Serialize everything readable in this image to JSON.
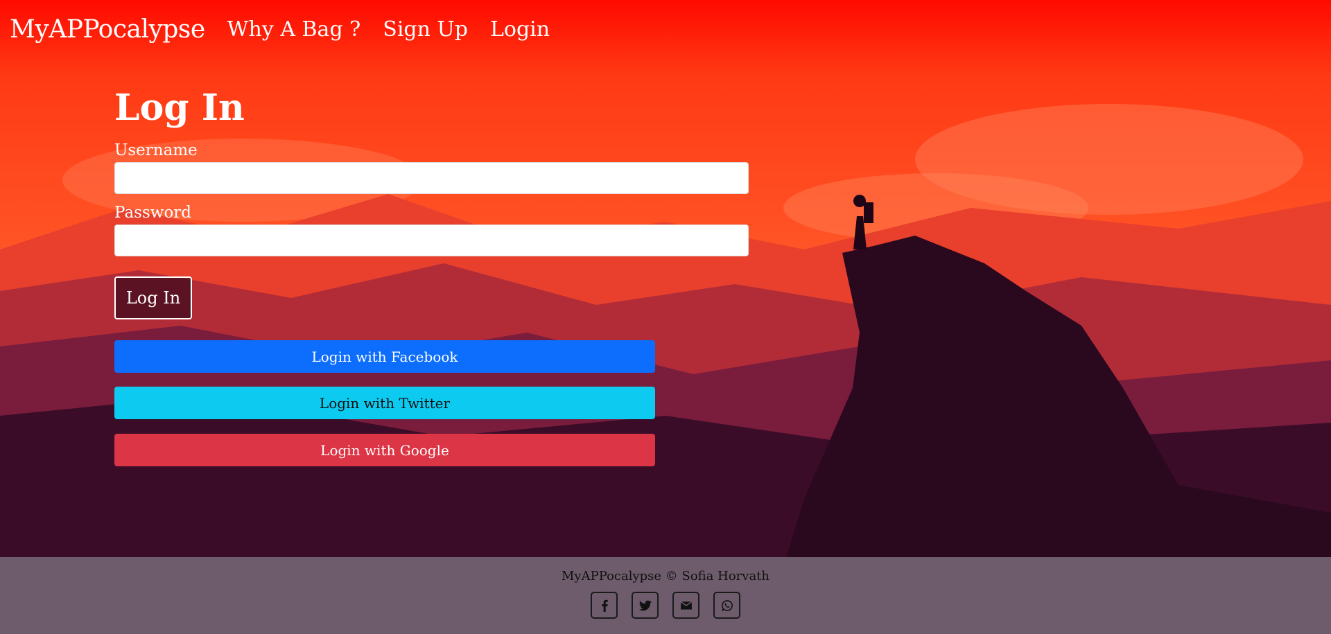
{
  "nav": {
    "brand": "MyAPPocalypse",
    "links": [
      {
        "label": "Why A Bag ?"
      },
      {
        "label": "Sign Up"
      },
      {
        "label": "Login"
      }
    ]
  },
  "login": {
    "title": "Log In",
    "username_label": "Username",
    "username_value": "",
    "password_label": "Password",
    "password_value": "",
    "submit_label": "Log In",
    "facebook_label": "Login with Facebook",
    "twitter_label": "Login with Twitter",
    "google_label": "Login with Google"
  },
  "footer": {
    "copyright": "MyAPPocalypse © Sofia Horvath",
    "icons": [
      "facebook-icon",
      "twitter-icon",
      "email-icon",
      "whatsapp-icon"
    ]
  },
  "colors": {
    "facebook": "#0d6efd",
    "twitter": "#0dcaf0",
    "google": "#dc3545",
    "sky_top": "#ff0a00",
    "footer_bg": "#6e5c6c"
  }
}
